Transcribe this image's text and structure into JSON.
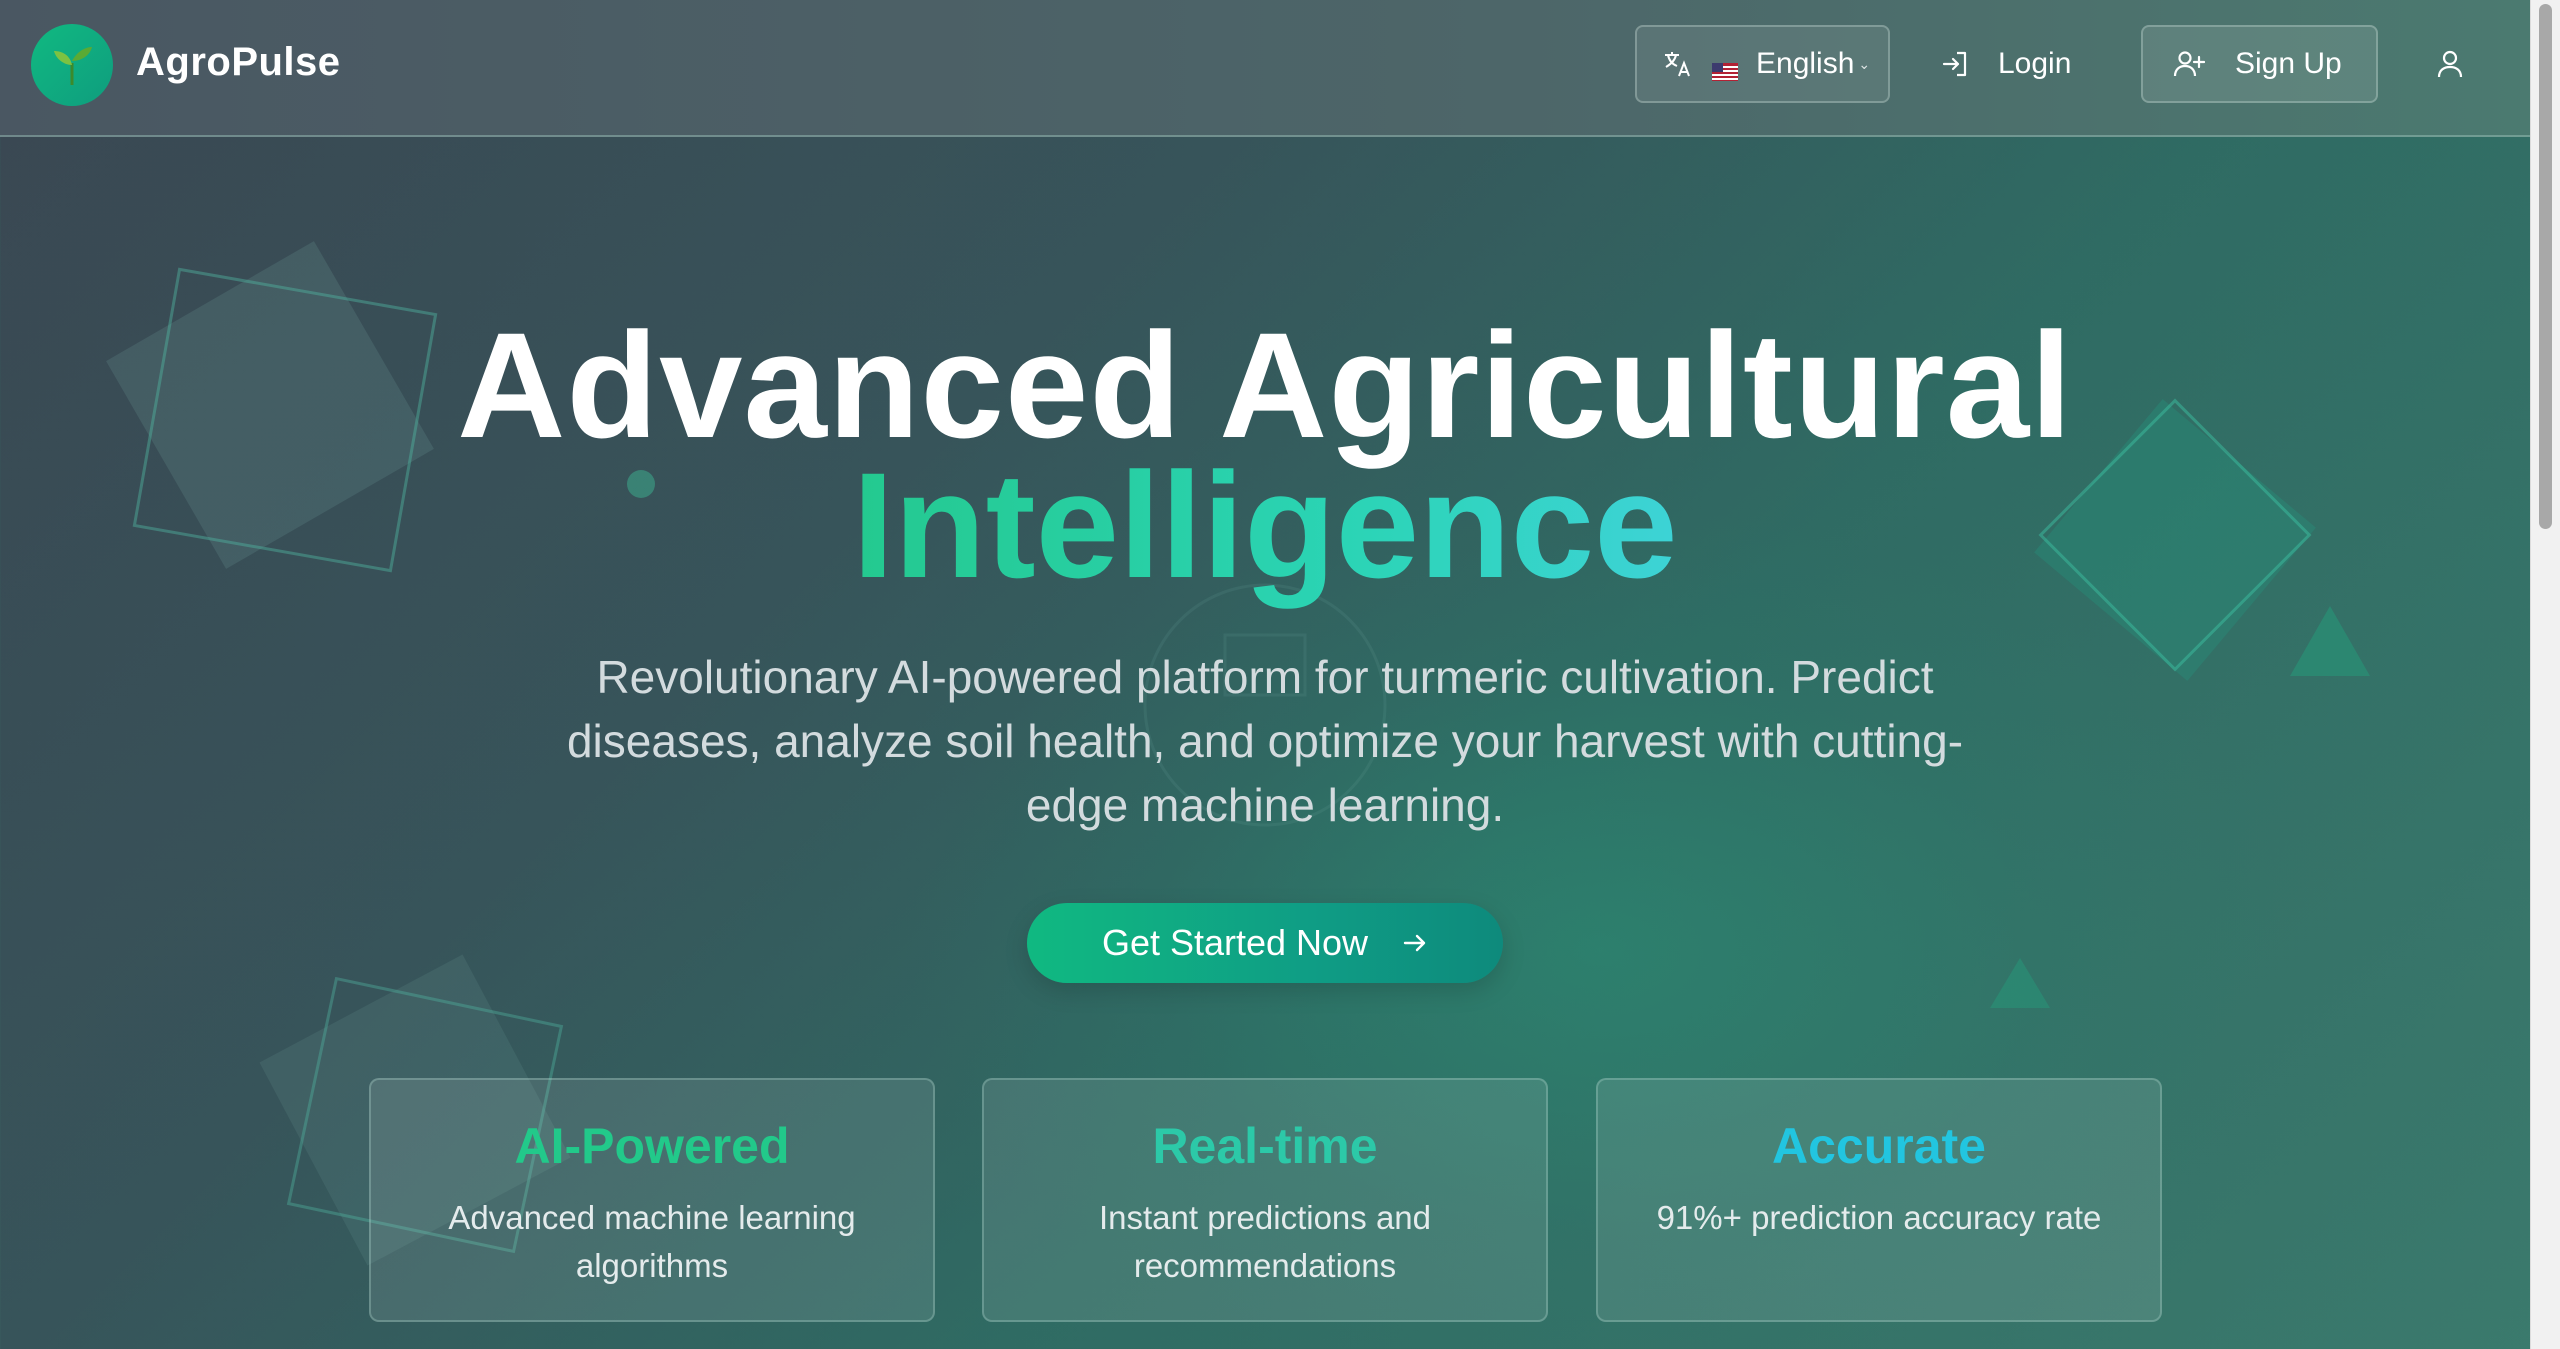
{
  "navbar": {
    "brand": "AgroPulse",
    "brand_icon": "seedling-icon",
    "language": {
      "selected": "English",
      "flag": "us-flag-icon",
      "icon": "translate-icon"
    },
    "login_label": "Login",
    "signup_label": "Sign Up",
    "user_icon": "user-icon"
  },
  "hero": {
    "title_line1": "Advanced Agricultural",
    "title_line2": "Intelligence",
    "subtitle": "Revolutionary AI-powered platform for turmeric cultivation. Predict diseases, analyze soil health, and optimize your harvest with cutting-edge machine learning.",
    "cta_label": "Get Started Now"
  },
  "features": [
    {
      "title": "AI-Powered",
      "description": "Advanced machine learning algorithms",
      "color": "#22c98a"
    },
    {
      "title": "Real-time",
      "description": "Instant predictions and recommendations",
      "color": "#2cc9a8"
    },
    {
      "title": "Accurate",
      "description": "91%+ prediction accuracy rate",
      "color": "#22c5e0"
    }
  ],
  "colors": {
    "accent": "#10b981",
    "accent_teal": "#2bd4b5",
    "background": "#37545a"
  }
}
